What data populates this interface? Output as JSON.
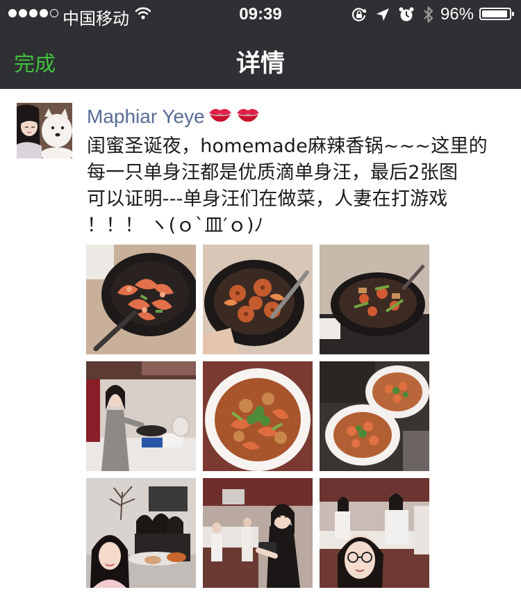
{
  "status_bar": {
    "carrier": "中国移动",
    "time": "09:39",
    "battery_percent": "96%",
    "battery_level": 0.96,
    "signal_bars": 4,
    "signal_total": 5,
    "icons": [
      "wifi-icon",
      "rotation-lock-icon",
      "location-icon",
      "alarm-icon",
      "bluetooth-icon"
    ]
  },
  "nav": {
    "back_label": "完成",
    "title": "详情",
    "accent_color": "#3fc13f",
    "bar_color": "#2e3033"
  },
  "post": {
    "author": "Maphiar Yeye",
    "author_emoji": [
      "kiss-mark-icon",
      "kiss-mark-icon"
    ],
    "author_color": "#576b95",
    "text_lines": [
      "闺蜜圣诞夜，homemade麻辣香锅~~~这里的",
      "每一只单身汪都是优质滴单身汪，最后2张图",
      "可以证明---单身汪们在做菜，人妻在打游戏",
      "！！！ ヽ(ｏ`皿′ｏ)ﾉ"
    ],
    "photos": [
      {
        "name": "photo-shrimp-wok",
        "scene": "wok"
      },
      {
        "name": "photo-lotus-wok",
        "scene": "wok"
      },
      {
        "name": "photo-wok-stove",
        "scene": "wok"
      },
      {
        "name": "photo-girl-cooking",
        "scene": "people"
      },
      {
        "name": "photo-plated-dish",
        "scene": "plate"
      },
      {
        "name": "photo-two-plates",
        "scene": "plate"
      },
      {
        "name": "photo-friends-selfie",
        "scene": "people"
      },
      {
        "name": "photo-kitchen-girl",
        "scene": "people"
      },
      {
        "name": "photo-kitchen-selfie",
        "scene": "people"
      }
    ]
  }
}
